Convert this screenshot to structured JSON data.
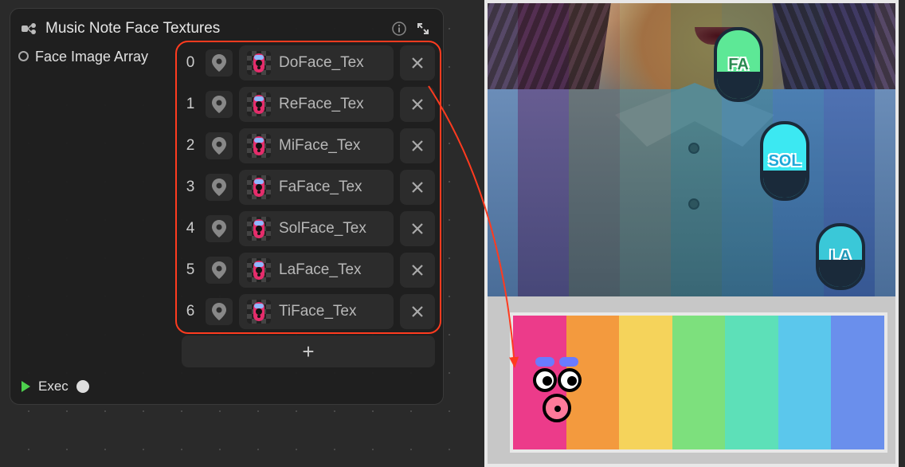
{
  "node": {
    "title": "Music Note Face Textures",
    "arrayLabel": "Face Image Array",
    "execLabel": "Exec",
    "items": [
      {
        "index": "0",
        "name": "DoFace_Tex"
      },
      {
        "index": "1",
        "name": "ReFace_Tex"
      },
      {
        "index": "2",
        "name": "MiFace_Tex"
      },
      {
        "index": "3",
        "name": "FaFace_Tex"
      },
      {
        "index": "4",
        "name": "SolFace_Tex"
      },
      {
        "index": "5",
        "name": "LaFace_Tex"
      },
      {
        "index": "6",
        "name": "TiFace_Tex"
      }
    ]
  },
  "notes": {
    "fa": "FA",
    "sol": "SOL",
    "la": "LA"
  },
  "palette": [
    "#ec3b8a",
    "#f39a3e",
    "#f5d35b",
    "#7de07d",
    "#5de0b8",
    "#5bc7ec",
    "#6a8fec"
  ],
  "overlayStripes": [
    "#e83b8a",
    "#f39a3e",
    "#f5d35b",
    "#7de07d",
    "#5de0b8",
    "#5bc7ec",
    "#6a8fec"
  ]
}
